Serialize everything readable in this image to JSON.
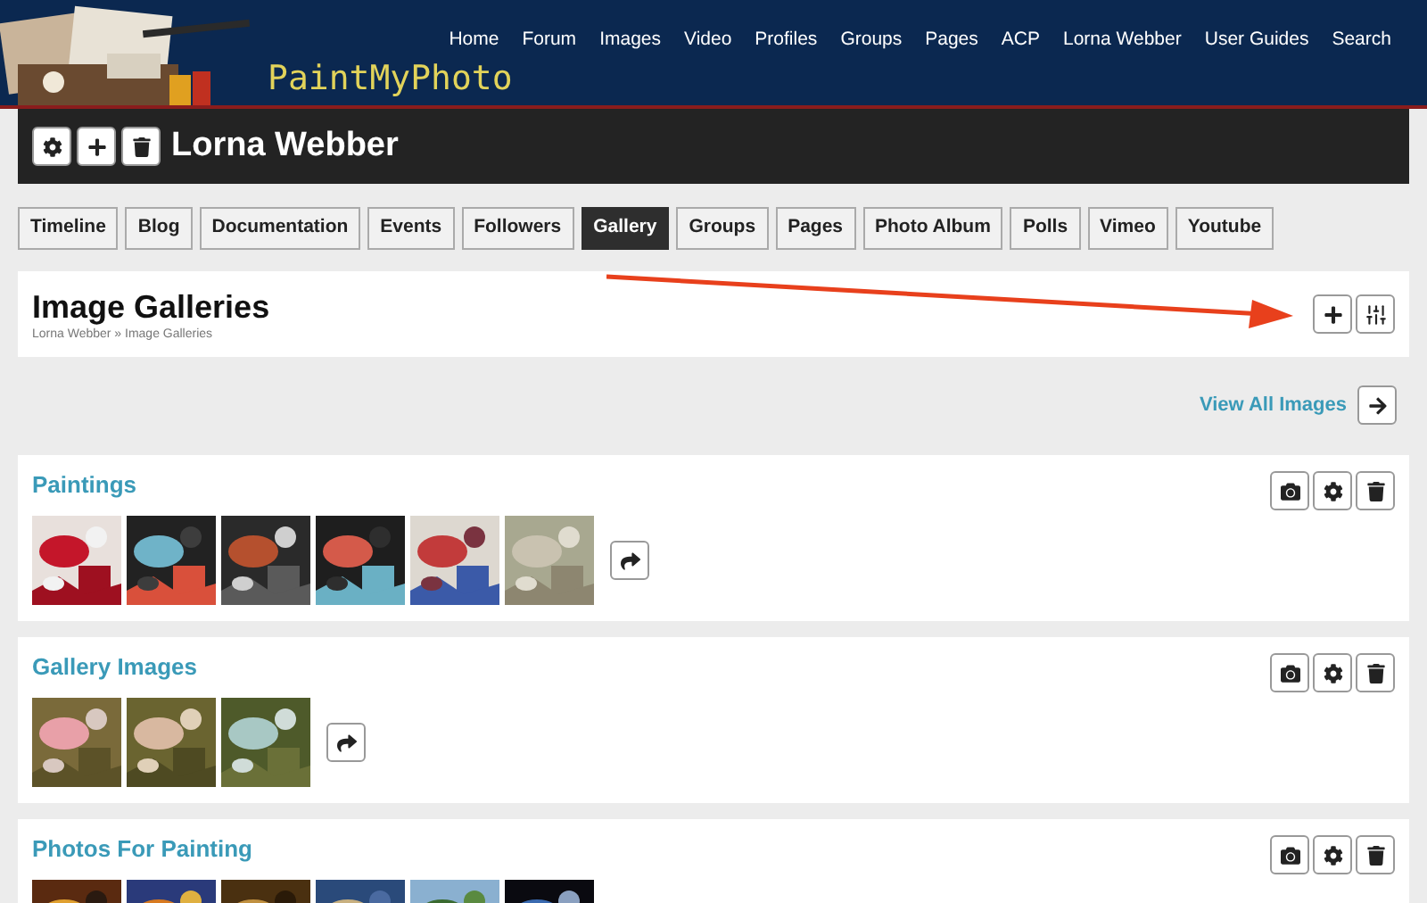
{
  "site": {
    "logo_text": "PaintMyPhoto",
    "nav": [
      "Home",
      "Forum",
      "Images",
      "Video",
      "Profiles",
      "Groups",
      "Pages",
      "ACP",
      "Lorna Webber",
      "User Guides",
      "Search"
    ]
  },
  "profile": {
    "name": "Lorna Webber"
  },
  "tabs": [
    {
      "label": "Timeline",
      "selected": false
    },
    {
      "label": "Blog",
      "selected": false
    },
    {
      "label": "Documentation",
      "selected": false
    },
    {
      "label": "Events",
      "selected": false
    },
    {
      "label": "Followers",
      "selected": false
    },
    {
      "label": "Gallery",
      "selected": true
    },
    {
      "label": "Groups",
      "selected": false
    },
    {
      "label": "Pages",
      "selected": false
    },
    {
      "label": "Photo Album",
      "selected": false
    },
    {
      "label": "Polls",
      "selected": false
    },
    {
      "label": "Vimeo",
      "selected": false
    },
    {
      "label": "Youtube",
      "selected": false
    }
  ],
  "page_header": {
    "title": "Image Galleries",
    "breadcrumb": "Lorna Webber » Image Galleries"
  },
  "view_all": {
    "label": "View All Images"
  },
  "galleries": [
    {
      "title": "Paintings"
    },
    {
      "title": "Gallery Images"
    },
    {
      "title": "Photos For Painting"
    }
  ]
}
